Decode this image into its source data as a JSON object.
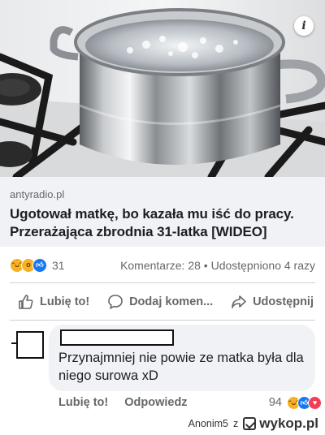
{
  "link": {
    "domain": "antyradio.pl",
    "title": "Ugotował matkę, bo kazała mu iść do pracy. Przerażająca zbrodnia 31-latka [WIDEO]",
    "info_icon": "info-icon",
    "image": "pot-of-boiling-water-on-gas-stove"
  },
  "stats": {
    "reactions": [
      "haha",
      "wow",
      "like"
    ],
    "reaction_count": "31",
    "comments_shares": "Komentarze: 28 • Udostępniono 4 razy"
  },
  "actions": {
    "like": "Lubię to!",
    "comment": "Dodaj komen...",
    "share": "Udostępnij"
  },
  "comment": {
    "text": "Przynajmniej nie powie ze matka była dla niego surowa xD",
    "like": "Lubię to!",
    "reply": "Odpowiedz",
    "reaction_count": "94",
    "reactions": [
      "haha",
      "like",
      "love"
    ]
  },
  "watermark": {
    "user": "Anonim5",
    "z": "z",
    "site": "wykop.pl"
  },
  "colors": {
    "like_blue": "#1877f2",
    "haha_yellow": "#f7b125",
    "love_red": "#f33e58",
    "secondary_text": "#65676b"
  }
}
